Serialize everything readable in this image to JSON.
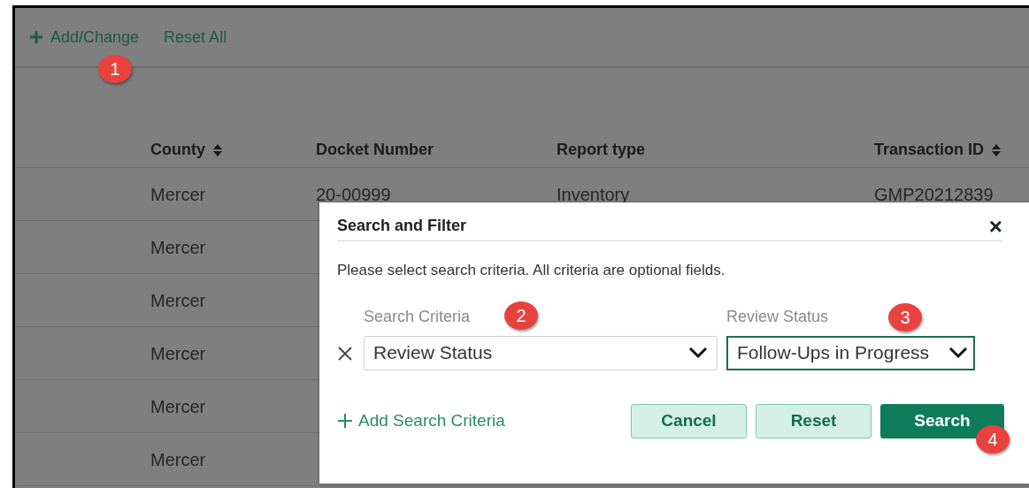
{
  "toolbar": {
    "actions": [
      {
        "kind": "add",
        "label": "Add/Change"
      },
      {
        "kind": "plain",
        "label": "Reset All"
      }
    ]
  },
  "table": {
    "columns": [
      {
        "label": "County",
        "sortable": true
      },
      {
        "label": "Docket Number",
        "sortable": false
      },
      {
        "label": "Report type",
        "sortable": false
      },
      {
        "label": "Transaction ID",
        "sortable": true
      }
    ],
    "rows": [
      {
        "cells": [
          "Mercer",
          "20-00999",
          "Inventory",
          "GMP20212839"
        ]
      },
      {
        "cells": [
          "Mercer"
        ]
      },
      {
        "cells": [
          "Mercer"
        ]
      },
      {
        "cells": [
          "Mercer"
        ]
      },
      {
        "cells": [
          "Mercer"
        ]
      },
      {
        "cells": [
          "Mercer"
        ]
      }
    ]
  },
  "dialog": {
    "title": "Search and Filter",
    "close": "×",
    "intro": "Please select search criteria. All criteria are optional fields.",
    "fields": [
      {
        "label": "Search Criteria",
        "value": "Review Status",
        "focused": false
      },
      {
        "label": "Review Status",
        "value": "Follow-Ups in Progress",
        "focused": true
      }
    ],
    "add_criteria": "Add Search Criteria",
    "buttons": [
      {
        "label": "Cancel",
        "primary": false
      },
      {
        "label": "Reset",
        "primary": false
      },
      {
        "label": "Search",
        "primary": true
      }
    ]
  },
  "annotations": [
    {
      "label": "1"
    },
    {
      "label": "2"
    },
    {
      "label": "3"
    },
    {
      "label": "4"
    }
  ]
}
